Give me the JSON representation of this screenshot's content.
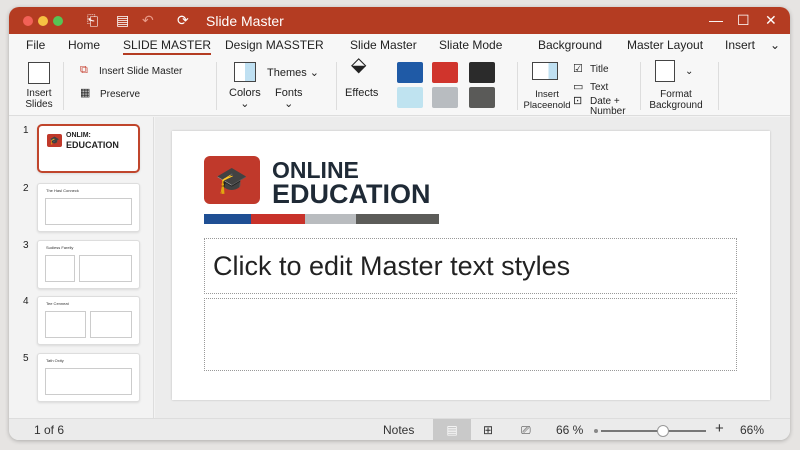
{
  "window": {
    "title": "Slide Master"
  },
  "tabs": [
    "File",
    "Home",
    "SLIDE MASTER",
    "Design MASSTER",
    "Slide Master",
    "Sliate Mode",
    "Background",
    "Master Layout",
    "Insert"
  ],
  "active_tab": "SLIDE MASTER",
  "ribbon": {
    "insert_slides": "Insert Slides",
    "insert_slide_master": "Insert Slide Master",
    "preserve": "Preserve",
    "themes": "Themes",
    "colors": "Colors",
    "fonts": "Fonts",
    "effects": "Effects",
    "swatches": [
      "#1f5aa6",
      "#d0342c",
      "#2b2b2b",
      "#bfe3f0",
      "#b8bcc0",
      "#5a5a58"
    ],
    "insert_placeholder": "Insert Placeenold",
    "title_label": "Title",
    "text_label": "Text",
    "date_label": "Date +",
    "number_label": "Number",
    "format_background": "Format Background"
  },
  "thumbnails": [
    {
      "num": "1",
      "title_line1": "ONLIM:",
      "title_line2": "EDUCATION",
      "selected": true
    },
    {
      "num": "2",
      "title": "The Hasl Conneck"
    },
    {
      "num": "3",
      "title": "Sudiess Fareliy"
    },
    {
      "num": "4",
      "title": "Tee Cenneat"
    },
    {
      "num": "5",
      "title": "Tath Oxity"
    }
  ],
  "slide": {
    "logo_line1": "ONLINE",
    "logo_line2": "EDUCATION",
    "brand_colors": [
      "#1f4f94",
      "#c8322a",
      "#b9bcbf",
      "#5c5c59"
    ],
    "placeholder_text": "Click to edit Master text styles"
  },
  "status": {
    "slide_count": "1 of 6",
    "notes": "Notes",
    "zoom_label": "66 %",
    "zoom_value": "66%",
    "zoom_percent": 66
  },
  "accent": "#b43c22"
}
